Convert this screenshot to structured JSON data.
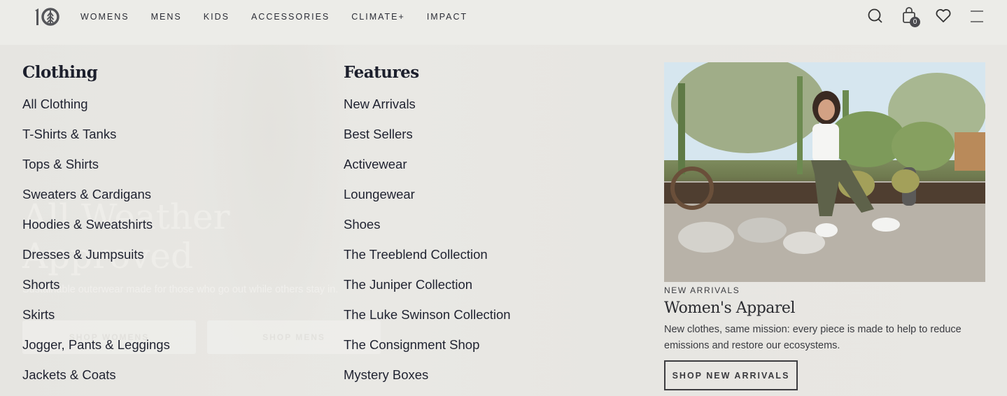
{
  "header": {
    "logo_text": "10",
    "nav": [
      "WOMENS",
      "MENS",
      "KIDS",
      "ACCESSORIES",
      "CLIMATE+",
      "IMPACT"
    ],
    "icons": [
      "search-icon",
      "cart-icon",
      "heart-icon",
      "menu-icon"
    ],
    "cart_count": "0"
  },
  "hero": {
    "title": "All Weather Approved",
    "subtitle": "Sustainable outerwear made for those who go out while others stay in.",
    "buttons": [
      "SHOP WOMENS",
      "SHOP MENS"
    ]
  },
  "menu": {
    "clothing": {
      "heading": "Clothing",
      "items": [
        "All Clothing",
        "T-Shirts & Tanks",
        "Tops & Shirts",
        "Sweaters & Cardigans",
        "Hoodies & Sweatshirts",
        "Dresses & Jumpsuits",
        "Shorts",
        "Skirts",
        "Jogger, Pants & Leggings",
        "Jackets & Coats"
      ]
    },
    "features": {
      "heading": "Features",
      "items": [
        "New Arrivals",
        "Best Sellers",
        "Activewear",
        "Loungewear",
        "Shoes",
        "The Treeblend Collection",
        "The Juniper Collection",
        "The Luke Swinson Collection",
        "The Consignment Shop",
        "Mystery Boxes"
      ]
    }
  },
  "promo": {
    "image_alt": "Woman in white tank and olive pants sitting on a wooden beam in a desert cactus garden",
    "label": "NEW ARRIVALS",
    "title": "Women's Apparel",
    "description": "New clothes, same mission: every piece is made to help to reduce emissions and restore our ecosystems.",
    "button": "SHOP NEW ARRIVALS"
  }
}
